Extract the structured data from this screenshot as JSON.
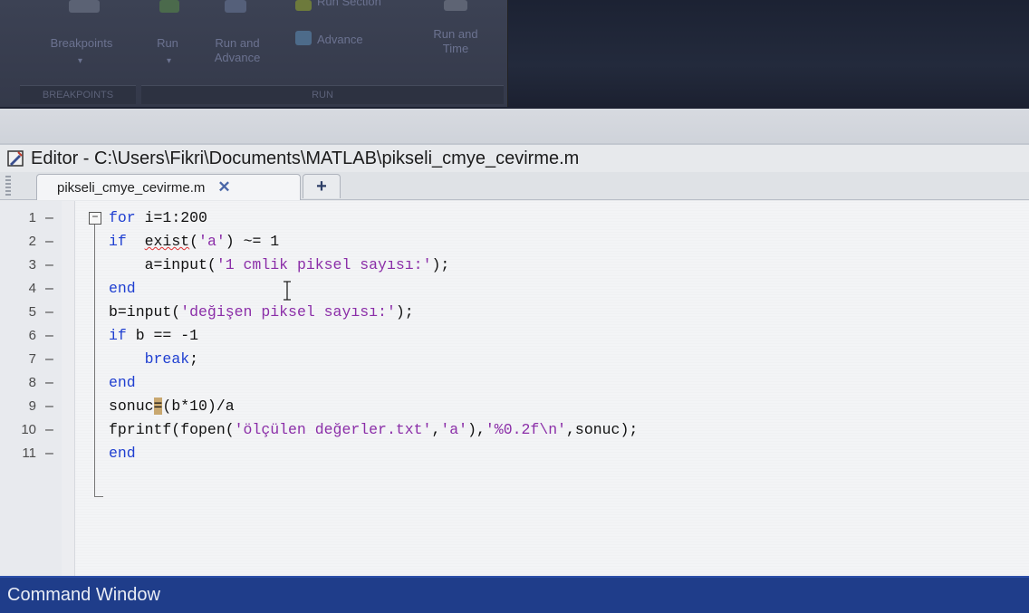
{
  "ribbon": {
    "breakpoints_label": "Breakpoints",
    "run_label": "Run",
    "run_and_advance_line1": "Run and",
    "run_and_advance_line2": "Advance",
    "run_section_label": "Run Section",
    "advance_label": "Advance",
    "run_and_time_line1": "Run and",
    "run_and_time_line2": "Time",
    "group_breakpoints": "BREAKPOINTS",
    "group_run": "RUN"
  },
  "editor": {
    "title": "Editor - C:\\Users\\Fikri\\Documents\\MATLAB\\pikseli_cmye_cevirme.m",
    "tab_label": "pikseli_cmye_cevirme.m",
    "close_glyph": "✕",
    "add_tab_glyph": "+",
    "fold_glyph": "−",
    "line_dash": "–"
  },
  "code_lines": [
    {
      "n": "1",
      "tokens": [
        {
          "t": "for",
          "c": "kw"
        },
        {
          "t": " i=1:200",
          "c": ""
        }
      ]
    },
    {
      "n": "2",
      "tokens": [
        {
          "t": "if",
          "c": "kw"
        },
        {
          "t": "  ",
          "c": ""
        },
        {
          "t": "exist",
          "c": "squig"
        },
        {
          "t": "(",
          "c": ""
        },
        {
          "t": "'a'",
          "c": "str"
        },
        {
          "t": ") ~= 1",
          "c": ""
        }
      ]
    },
    {
      "n": "3",
      "tokens": [
        {
          "t": "    a=input(",
          "c": ""
        },
        {
          "t": "'1 cmlik piksel sayısı:'",
          "c": "str"
        },
        {
          "t": ");",
          "c": ""
        }
      ]
    },
    {
      "n": "4",
      "tokens": [
        {
          "t": "end",
          "c": "kw"
        }
      ]
    },
    {
      "n": "5",
      "tokens": [
        {
          "t": "b=input(",
          "c": ""
        },
        {
          "t": "'değişen piksel sayısı:'",
          "c": "str"
        },
        {
          "t": ");",
          "c": ""
        }
      ]
    },
    {
      "n": "6",
      "tokens": [
        {
          "t": "if",
          "c": "kw"
        },
        {
          "t": " b == -1",
          "c": ""
        }
      ]
    },
    {
      "n": "7",
      "tokens": [
        {
          "t": "    ",
          "c": ""
        },
        {
          "t": "break",
          "c": "kw"
        },
        {
          "t": ";",
          "c": ""
        }
      ]
    },
    {
      "n": "8",
      "tokens": [
        {
          "t": "end",
          "c": "kw"
        }
      ]
    },
    {
      "n": "9",
      "tokens": [
        {
          "t": "sonuc",
          "c": ""
        },
        {
          "t": "=",
          "c": "caret"
        },
        {
          "t": "(b*10)/a",
          "c": ""
        }
      ]
    },
    {
      "n": "10",
      "tokens": [
        {
          "t": "fprintf(fopen(",
          "c": ""
        },
        {
          "t": "'ölçülen değerler.txt'",
          "c": "str"
        },
        {
          "t": ",",
          "c": ""
        },
        {
          "t": "'a'",
          "c": "str"
        },
        {
          "t": "),",
          "c": ""
        },
        {
          "t": "'%0.2f\\n'",
          "c": "str"
        },
        {
          "t": ",sonuc);",
          "c": ""
        }
      ]
    },
    {
      "n": "11",
      "tokens": [
        {
          "t": "end",
          "c": "kw"
        }
      ]
    }
  ],
  "command_window": {
    "title": "Command Window"
  }
}
